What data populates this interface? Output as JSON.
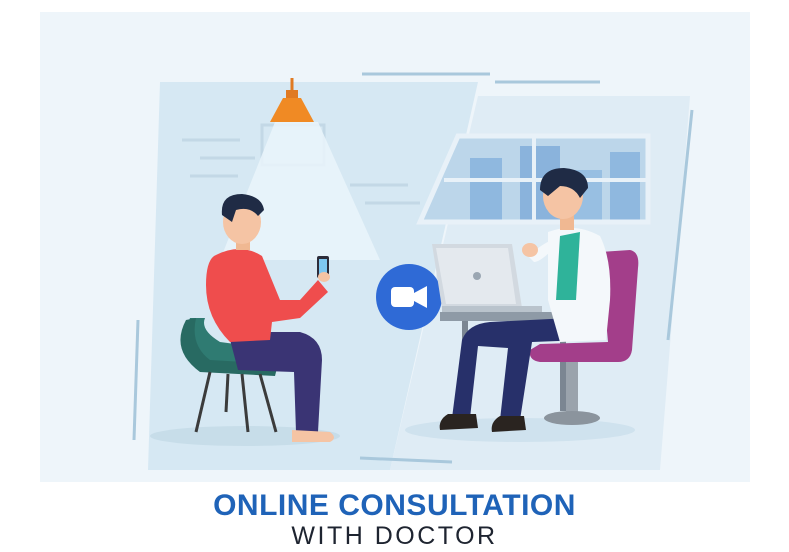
{
  "caption": {
    "line1": "ONLINE CONSULTATION",
    "line2": "WITH DOCTOR"
  },
  "colors": {
    "background": "#ffffff",
    "panel_light": "#d9eaf4",
    "panel_medium": "#c4dcec",
    "lamp_shade": "#f08a24",
    "patient_shirt": "#ef4d4d",
    "patient_pants": "#3a3474",
    "patient_chair": "#2f7b72",
    "doctor_coat": "#f4f8fb",
    "doctor_shirt": "#2fb39a",
    "doctor_pants": "#27306a",
    "doctor_chair": "#a33e8a",
    "video_call_button": "#2f6ad6",
    "title_blue": "#1f63b8",
    "subtitle_dark": "#1e2430"
  },
  "icons": {
    "video_call": "video-camera-icon",
    "phone": "smartphone-icon",
    "lamp": "ceiling-lamp-icon"
  }
}
